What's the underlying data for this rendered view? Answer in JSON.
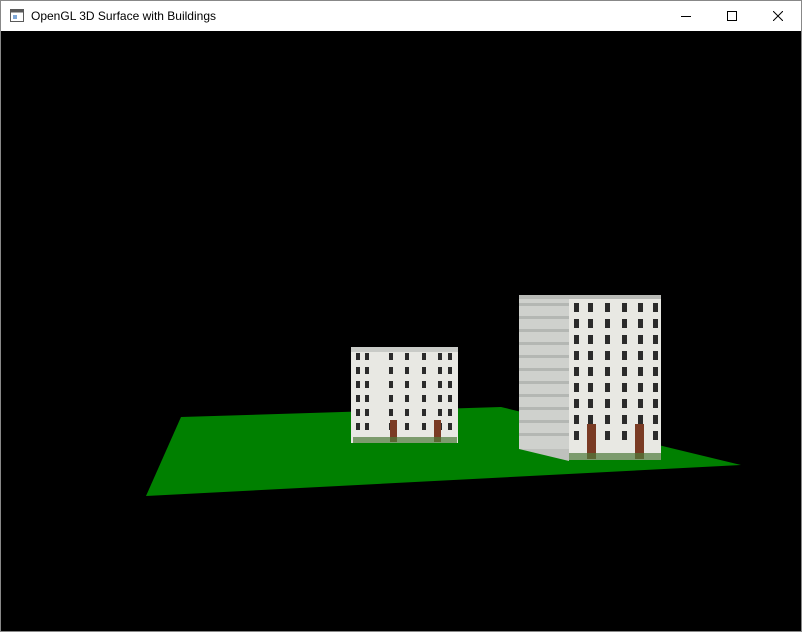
{
  "window": {
    "title": "OpenGL 3D Surface with Buildings",
    "icon": "window-app-icon",
    "controls": {
      "minimize_icon": "minimize-icon",
      "maximize_icon": "maximize-icon",
      "close_icon": "close-icon"
    }
  },
  "scene": {
    "background_color": "#000000",
    "ground_color": "#008000",
    "buildings": [
      {
        "name": "small-building",
        "facade_color": "#e8e8e3",
        "window_color": "#2b2b2b",
        "door_color": "#7a3b24",
        "plant_color": "#4e7a3a"
      },
      {
        "name": "tall-building",
        "facade_color": "#e8e8e3",
        "side_color": "#cfd1cd",
        "window_color": "#2b2b2b",
        "door_color": "#7a3b24",
        "plant_color": "#4e7a3a"
      }
    ]
  }
}
